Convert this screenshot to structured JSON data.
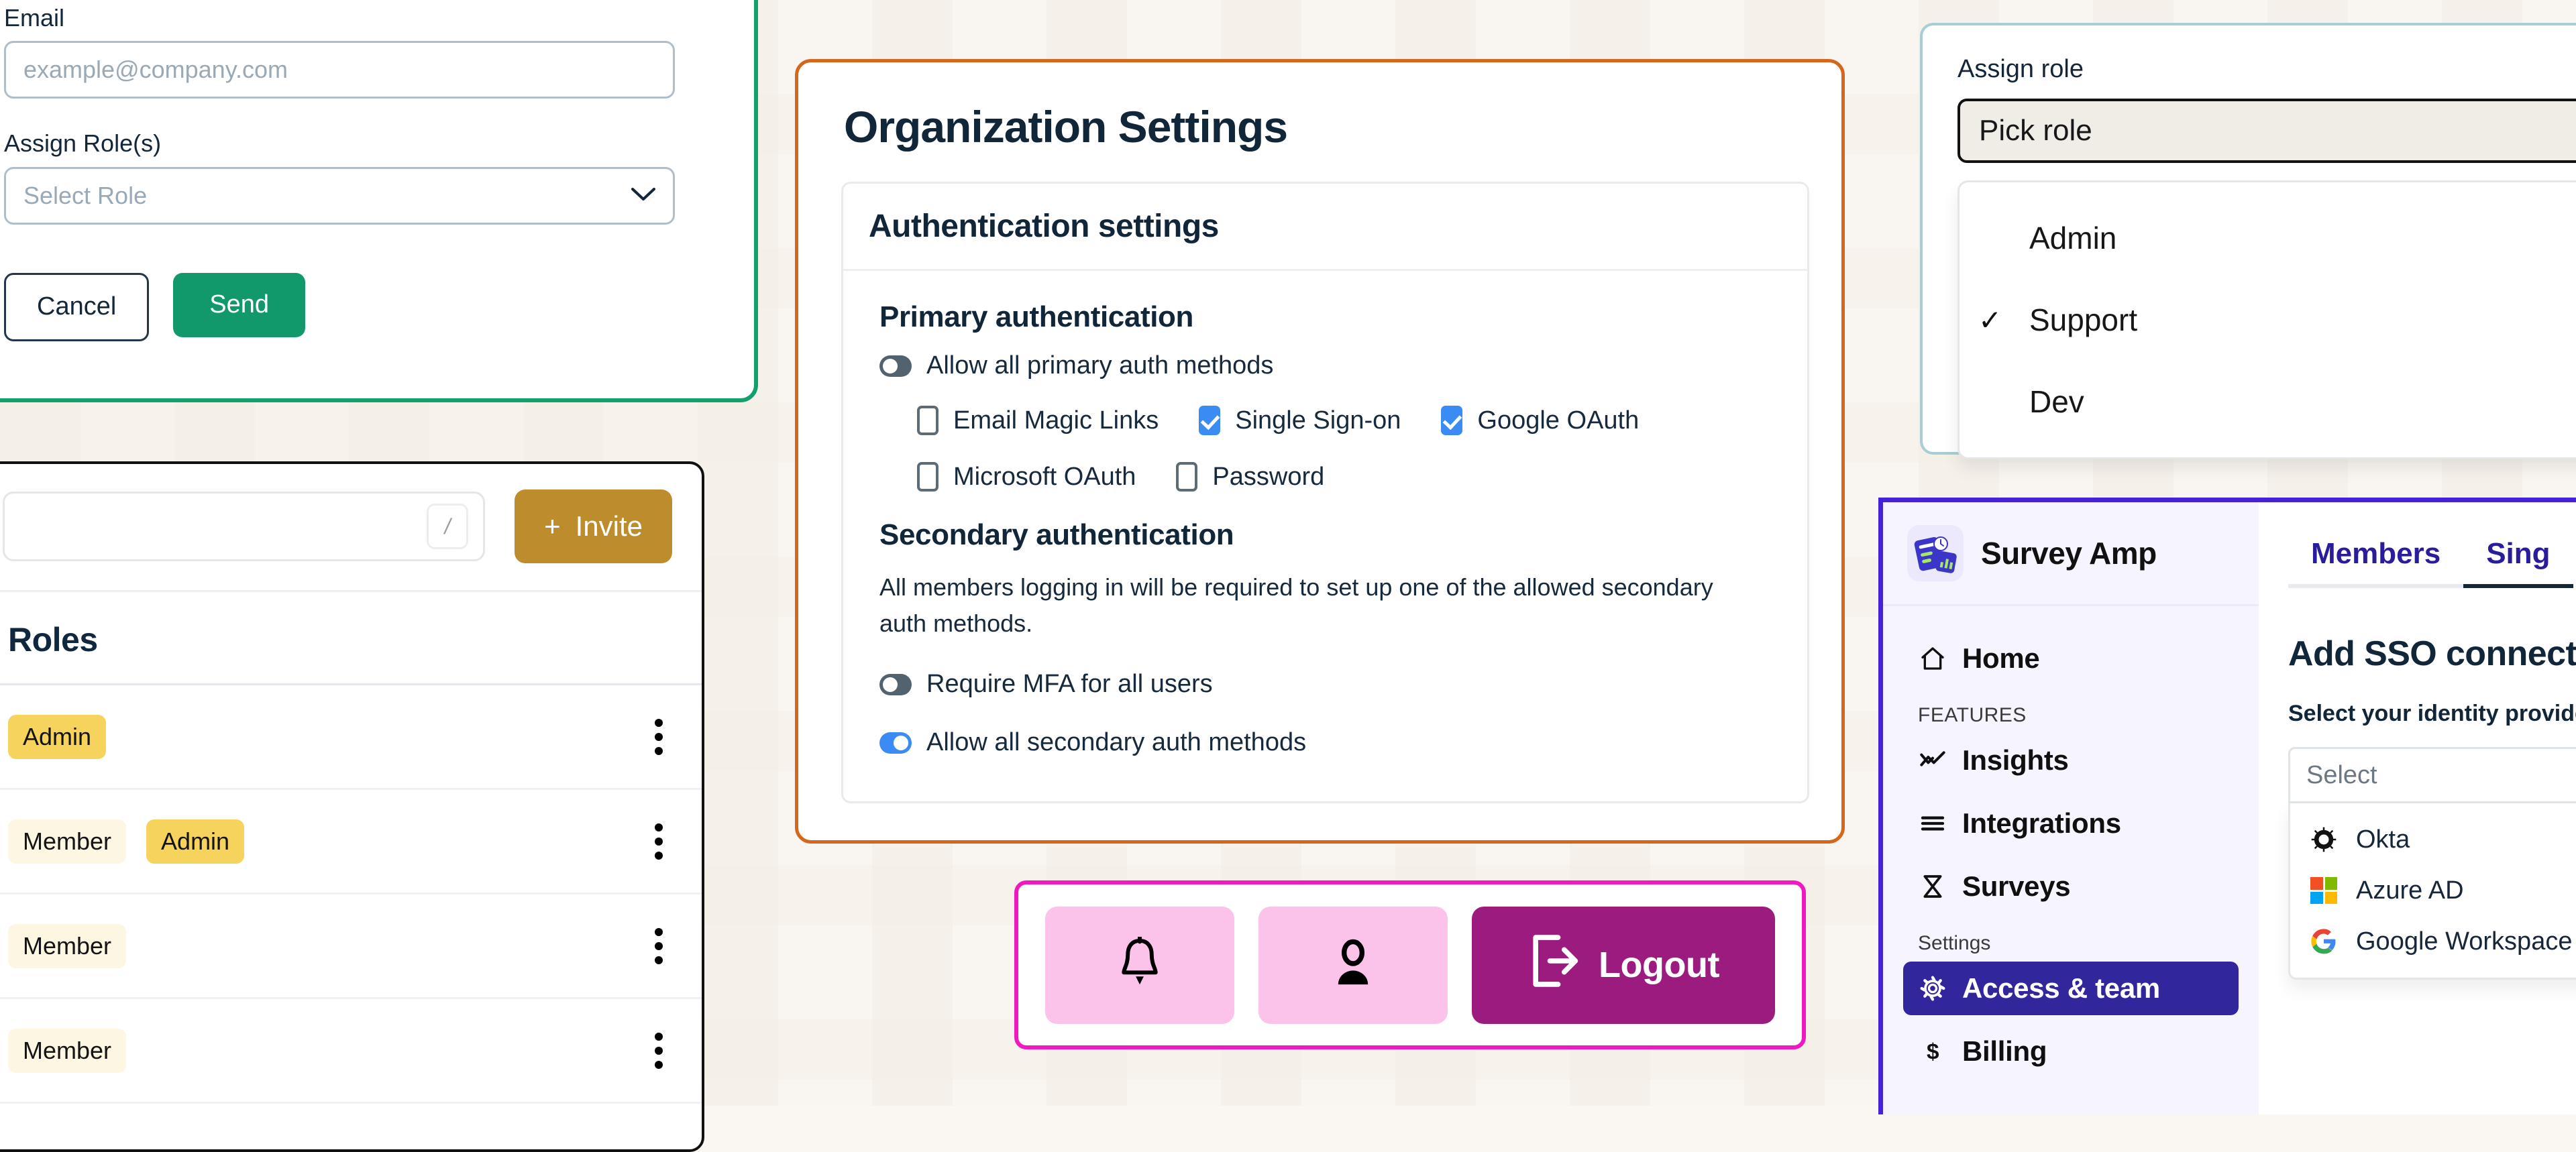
{
  "invite_card": {
    "email_label": "Email",
    "email_placeholder": "example@company.com",
    "email_value": "",
    "role_label": "Assign Role(s)",
    "role_placeholder": "Select Role",
    "cancel_label": "Cancel",
    "send_label": "Send",
    "accent": "#13a06f"
  },
  "members_card": {
    "search_value": "",
    "search_shortcut": "/",
    "invite_label": "Invite",
    "invite_plus": "+",
    "invite_color": "#bd8c2c",
    "roles_title": "Roles",
    "rows": [
      {
        "tags": [
          {
            "text": "Admin",
            "style": "admin"
          }
        ]
      },
      {
        "tags": [
          {
            "text": "Member",
            "style": "member"
          },
          {
            "text": "Admin",
            "style": "admin"
          }
        ]
      },
      {
        "tags": [
          {
            "text": "Member",
            "style": "member"
          }
        ]
      },
      {
        "tags": [
          {
            "text": "Member",
            "style": "member"
          }
        ]
      }
    ]
  },
  "org_settings": {
    "title": "Organization Settings",
    "panel_title": "Authentication settings",
    "accent": "#d4671c",
    "primary": {
      "title": "Primary authentication",
      "toggle_label": "Allow all primary auth methods",
      "toggle_state": "off",
      "checkboxes": [
        {
          "label": "Email Magic Links",
          "checked": false
        },
        {
          "label": "Single Sign-on",
          "checked": true
        },
        {
          "label": "Google OAuth",
          "checked": true
        },
        {
          "label": "Microsoft OAuth",
          "checked": false
        },
        {
          "label": "Password",
          "checked": false
        }
      ]
    },
    "secondary": {
      "title": "Secondary authentication",
      "description": "All members logging in will be required to set up one of the allowed secondary auth methods.",
      "toggles": [
        {
          "label": "Require MFA for all users",
          "state": "off"
        },
        {
          "label": "Allow all secondary auth methods",
          "state": "on"
        }
      ]
    }
  },
  "logout_bar": {
    "border_color": "#f019c0",
    "notifications_icon": "bell-icon",
    "account_icon": "user-icon",
    "logout_label": "Logout",
    "logout_color": "#9c1b7f"
  },
  "assign_role": {
    "label": "Assign role",
    "button_text": "Pick role",
    "options": [
      {
        "label": "Admin",
        "selected": false
      },
      {
        "label": "Support",
        "selected": true
      },
      {
        "label": "Dev",
        "selected": false
      }
    ],
    "check_glyph": "✓"
  },
  "survey_amp": {
    "brand": "Survey Amp",
    "accent": "#4322d8",
    "nav": [
      {
        "label": "Home",
        "icon": "home-icon",
        "active": false,
        "type": "item"
      },
      {
        "label": "FEATURES",
        "type": "group"
      },
      {
        "label": "Insights",
        "icon": "insights-icon",
        "active": false,
        "type": "item"
      },
      {
        "label": "Integrations",
        "icon": "integrations-icon",
        "active": false,
        "type": "item"
      },
      {
        "label": "Surveys",
        "icon": "surveys-icon",
        "active": false,
        "type": "item"
      },
      {
        "label": "Settings",
        "type": "group"
      },
      {
        "label": "Access & team",
        "icon": "gear-icon",
        "active": true,
        "type": "item"
      },
      {
        "label": "Billing",
        "icon": "dollar-icon",
        "active": false,
        "type": "item"
      }
    ],
    "tabs": [
      {
        "label": "Members",
        "active": false
      },
      {
        "label": "Sing",
        "active": true
      }
    ],
    "heading": "Add SSO connectio",
    "subheading": "Select your identity provider",
    "select_placeholder": "Select",
    "providers": [
      {
        "label": "Okta",
        "icon": "okta-icon"
      },
      {
        "label": "Azure AD",
        "icon": "microsoft-icon"
      },
      {
        "label": "Google Workspace",
        "icon": "google-icon"
      }
    ]
  }
}
